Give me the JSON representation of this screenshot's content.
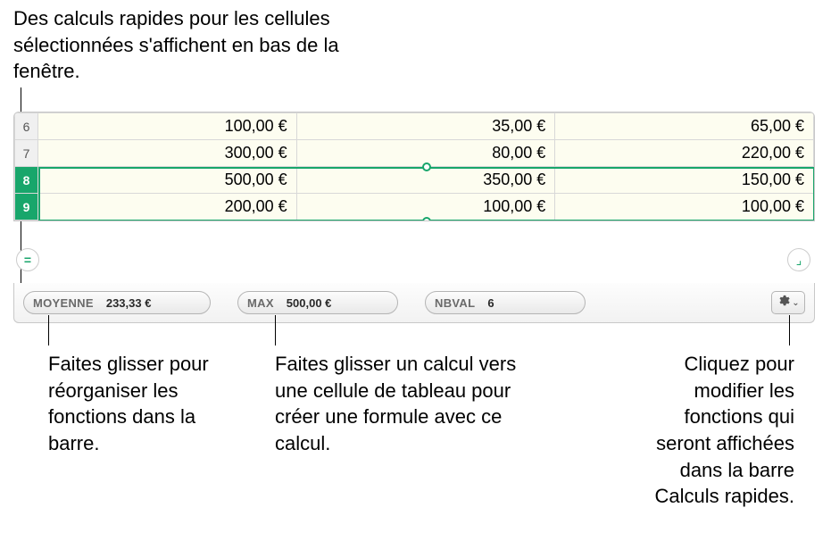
{
  "callouts": {
    "top": "Des calculs rapides pour les cellules sélectionnées s'affichent en bas de la fenêtre.",
    "left": "Faites glisser pour réorganiser les fonctions dans la barre.",
    "middle": "Faites glisser un calcul vers une cellule de tableau pour créer une formule avec ce calcul.",
    "right": "Cliquez pour modifier les fonctions qui seront affichées dans la barre Calculs rapides."
  },
  "table": {
    "rows": [
      {
        "n": "6",
        "c1": "100,00 €",
        "c2": "35,00 €",
        "c3": "65,00 €",
        "selected": false
      },
      {
        "n": "7",
        "c1": "300,00 €",
        "c2": "80,00 €",
        "c3": "220,00 €",
        "selected": false
      },
      {
        "n": "8",
        "c1": "500,00 €",
        "c2": "350,00 €",
        "c3": "150,00 €",
        "selected": true
      },
      {
        "n": "9",
        "c1": "200,00 €",
        "c2": "100,00 €",
        "c3": "100,00 €",
        "selected": true
      }
    ]
  },
  "quickcalc": {
    "items": [
      {
        "label": "MOYENNE",
        "value": "233,33 €"
      },
      {
        "label": "MAX",
        "value": "500,00 €"
      },
      {
        "label": "NBVAL",
        "value": "6"
      }
    ]
  },
  "icons": {
    "equals": "=",
    "corner": "⌟",
    "chevron": "⌄"
  }
}
